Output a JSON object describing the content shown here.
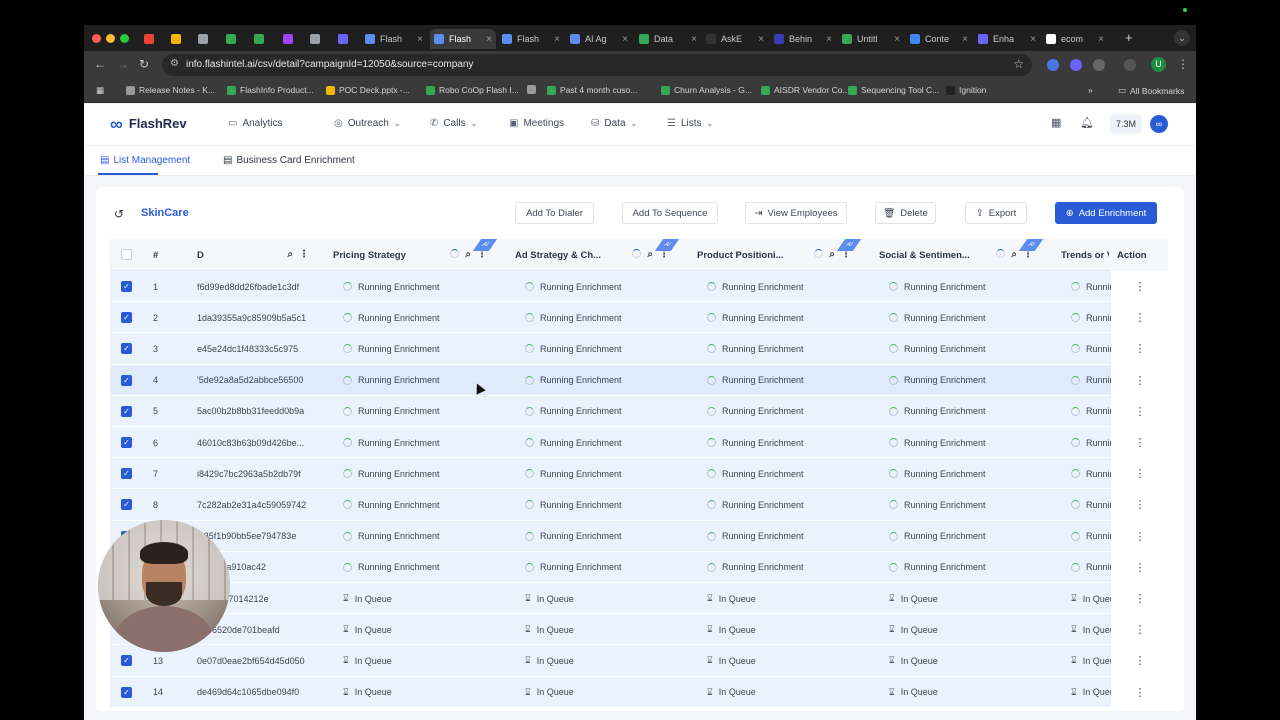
{
  "browser": {
    "tabs": [
      {
        "label": "",
        "color": "#ea4335"
      },
      {
        "label": "",
        "color": "#f4b400"
      },
      {
        "label": "",
        "color": "#9aa0a6"
      },
      {
        "label": "",
        "color": "#34a853"
      },
      {
        "label": "",
        "color": "#34a853"
      },
      {
        "label": "",
        "color": "#a142f4"
      },
      {
        "label": "",
        "color": "#9aa0a6"
      },
      {
        "label": "",
        "color": "#6b63ff"
      },
      {
        "label": "Flash",
        "color": "#5b8def"
      },
      {
        "label": "Flash",
        "color": "#5b8def"
      },
      {
        "label": "Flash",
        "color": "#5b8def"
      },
      {
        "label": "AI Ag",
        "color": "#5b8def"
      },
      {
        "label": "Data",
        "color": "#34a853"
      },
      {
        "label": "AskE",
        "color": "#333333"
      },
      {
        "label": "Behin",
        "color": "#3b3bb3"
      },
      {
        "label": "Untitl",
        "color": "#34a853"
      },
      {
        "label": "Conte",
        "color": "#4285f4"
      },
      {
        "label": "Enha",
        "color": "#6b63ff"
      },
      {
        "label": "ecom",
        "color": "#ffffff"
      }
    ],
    "url": "info.flashintel.ai/csv/detail?campaignId=12050&source=company",
    "profile_initial": "U",
    "bookmarks": [
      "Release Notes - K...",
      "FlashInfo Product...",
      "POC Deck.pptx -...",
      "Robo CoOp Flash I...",
      "",
      "Past 4 month cuso...",
      "Churn Analysis - G...",
      "AISDR Vendor Co...",
      "Sequencing Tool C...",
      "Ignition"
    ],
    "all_bookmarks": "All Bookmarks"
  },
  "app": {
    "brand": "FlashRev",
    "nav": [
      {
        "label": "Analytics",
        "icon": "monitor-icon",
        "glyph": "▭",
        "chevron": false
      },
      {
        "label": "Outreach",
        "icon": "outreach-icon",
        "glyph": "◎",
        "chevron": true
      },
      {
        "label": "Calls",
        "icon": "phone-icon",
        "glyph": "✆",
        "chevron": true
      },
      {
        "label": "Meetings",
        "icon": "camera-icon",
        "glyph": "▣",
        "chevron": false
      },
      {
        "label": "Data",
        "icon": "database-icon",
        "glyph": "⛁",
        "chevron": true
      },
      {
        "label": "Lists",
        "icon": "list-icon",
        "glyph": "☰",
        "chevron": true
      }
    ],
    "credits": "7.3M",
    "subtabs": [
      "List Management",
      "Business Card Enrichment"
    ]
  },
  "list": {
    "title": "SkinCare",
    "actions": {
      "add_to_dialer": "Add To Dialer",
      "add_to_sequence": "Add To Sequence",
      "view_employees": "View Employees",
      "delete": "Delete",
      "export": "Export",
      "add_enrichment": "Add Enrichment"
    }
  },
  "table": {
    "columns": {
      "index": "#",
      "id": "D",
      "pricing": "Pricing Strategy",
      "ad": "Ad Strategy & Ch...",
      "product": "Product Positioni...",
      "social": "Social & Sentimen...",
      "trends": "Trends or V",
      "action": "Action"
    },
    "ai_badge": "AI",
    "status_running": "Running Enrichment",
    "status_queue": "In Queue",
    "trends_running": "Running",
    "trends_queue": "In Queue",
    "rows": [
      {
        "n": "1",
        "id": "f6d99ed8dd26fbade1c3df",
        "status": "running"
      },
      {
        "n": "2",
        "id": "1da39355a9c85909b5a5c1",
        "status": "running"
      },
      {
        "n": "3",
        "id": "e45e24dc1f48333c5c975",
        "status": "running"
      },
      {
        "n": "4",
        "id": "'5de92a8a5d2abbce56500",
        "status": "running"
      },
      {
        "n": "5",
        "id": "5ac00b2b8bb31feedd0b9a",
        "status": "running"
      },
      {
        "n": "6",
        "id": "46010c83b63b09d426be...",
        "status": "running"
      },
      {
        "n": "7",
        "id": "i8429c7bc2963a5b2db79f",
        "status": "running"
      },
      {
        "n": "8",
        "id": "7c282ab2e31a4c59059742",
        "status": "running"
      },
      {
        "n": "",
        "id": "'485f1b90bb5ee794783e",
        "status": "running"
      },
      {
        "n": "",
        "id": "2e4118a910ac42",
        "status": "running"
      },
      {
        "n": "",
        "id": "i7e73c07014212e",
        "status": "queue"
      },
      {
        "n": "",
        "id": "0e96520de701beafd",
        "status": "queue"
      },
      {
        "n": "13",
        "id": "0e07d0eae2bf654d45d050",
        "status": "queue"
      },
      {
        "n": "14",
        "id": "de469d64c1065dbe094f0",
        "status": "queue"
      }
    ]
  },
  "colors": {
    "accent": "#2a5bd7",
    "row_bg": "#eaf2fd"
  }
}
